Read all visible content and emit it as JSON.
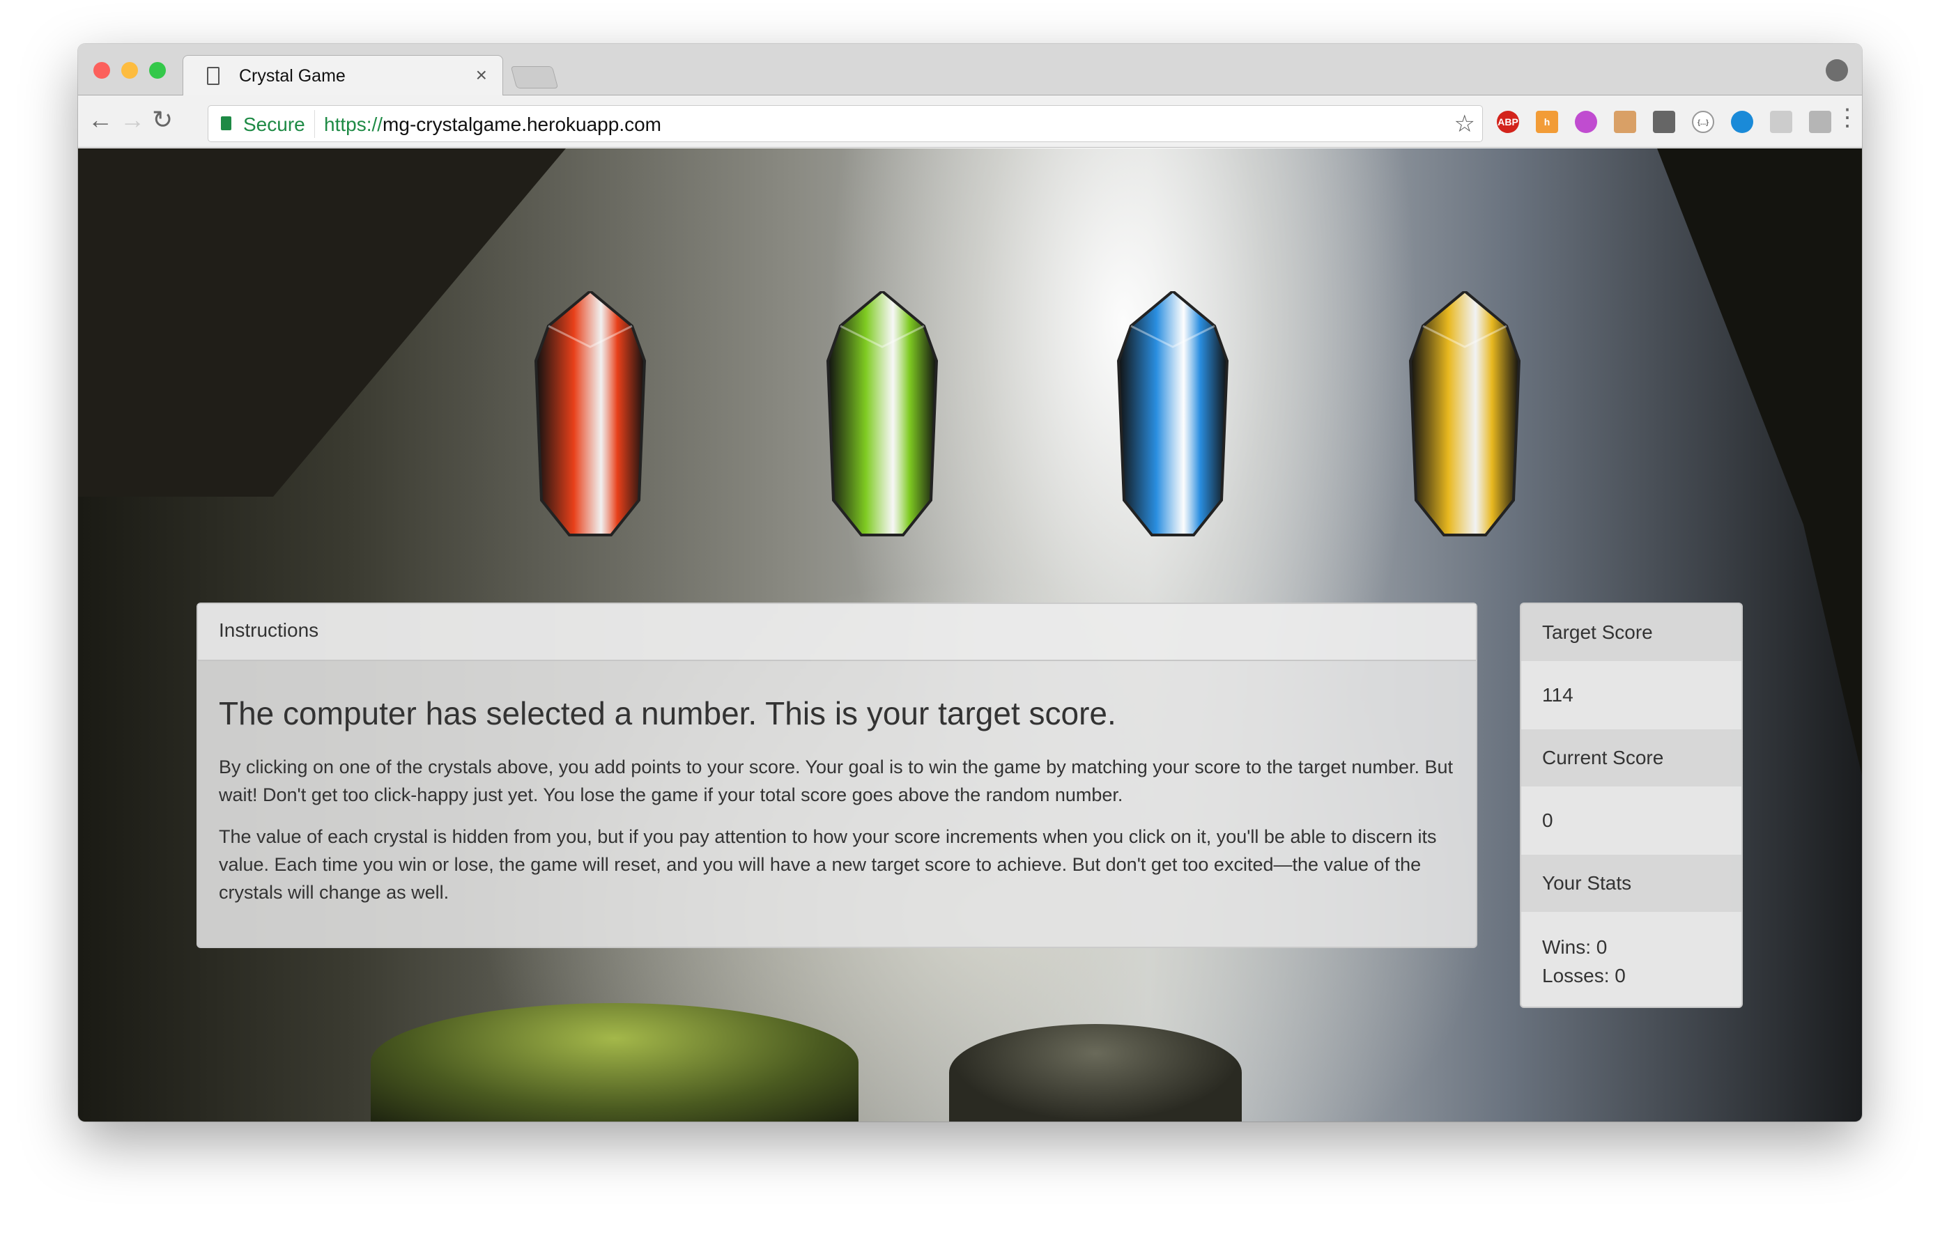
{
  "browser": {
    "tab_title": "Crystal Game",
    "secure_label": "Secure",
    "url_scheme": "https://",
    "url_host": "mg-crystalgame.herokuapp.com",
    "extensions": [
      {
        "name": "adblock-plus",
        "label": "ABP",
        "color": "#d3231b"
      },
      {
        "name": "honey",
        "label": "h",
        "color": "#f29c37"
      },
      {
        "name": "color-picker",
        "label": "",
        "color": "#c04cd0"
      },
      {
        "name": "ruler",
        "label": "",
        "color": "#d9a066"
      },
      {
        "name": "pocket",
        "label": "",
        "color": "#666666"
      },
      {
        "name": "json-viewer",
        "label": "{...}",
        "color": "#ffffff"
      },
      {
        "name": "vue-devtools",
        "label": "",
        "color": "#1a8ad8"
      },
      {
        "name": "dropbox",
        "label": "",
        "color": "#cccccc"
      },
      {
        "name": "react-devtools",
        "label": "",
        "color": "#b5b5b5"
      }
    ]
  },
  "crystals": [
    {
      "name": "red",
      "color": "#e8401a"
    },
    {
      "name": "green",
      "color": "#7fcb22"
    },
    {
      "name": "blue",
      "color": "#2a8ee0"
    },
    {
      "name": "yellow",
      "color": "#e8b820"
    }
  ],
  "instructions": {
    "header": "Instructions",
    "heading": "The computer has selected a number. This is your target score.",
    "p1": "By clicking on one of the crystals above, you add points to your score. Your goal is to win the game by matching your score to the target number. But wait! Don't get too click-happy just yet. You lose the game if your total score goes above the random number.",
    "p2": "The value of each crystal is hidden from you, but if you pay attention to how your score increments when you click on it, you'll be able to discern its value. Each time you win or lose, the game will reset, and you will have a new target score to achieve. But don't get too excited—the value of the crystals will change as well."
  },
  "stats": {
    "target_label": "Target Score",
    "target_value": "114",
    "current_label": "Current Score",
    "current_value": "0",
    "stats_label": "Your Stats",
    "wins": "Wins: 0",
    "losses": "Losses: 0"
  }
}
